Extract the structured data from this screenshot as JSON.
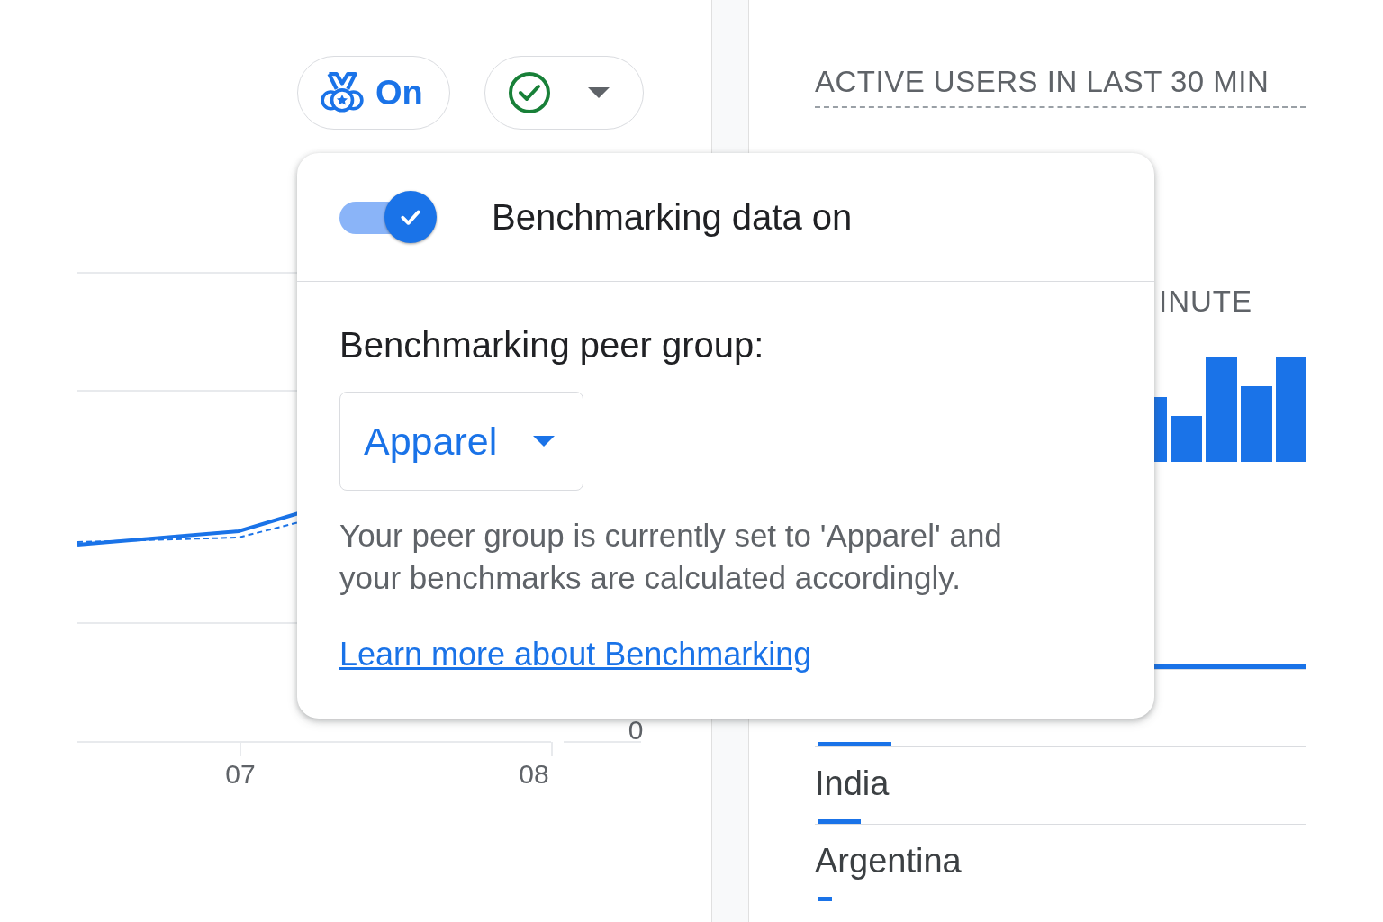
{
  "toolbar": {
    "benchmark_button": {
      "label": "On"
    }
  },
  "trend_chart": {
    "x_labels": [
      "07",
      "08"
    ],
    "y_labels": [
      "0"
    ]
  },
  "realtime": {
    "title": "ACTIVE USERS IN LAST 30 MIN",
    "subtitle": "INUTE",
    "countries": [
      {
        "level": 1
      },
      {
        "level": 0.15
      },
      {
        "name": "India",
        "level": 0.087
      },
      {
        "name": "Argentina",
        "level": 0.028
      }
    ]
  },
  "benchmark_popup": {
    "toggle": {
      "label": "Benchmarking data on",
      "on": true
    },
    "peer_group_label": "Benchmarking peer group:",
    "peer_group": {
      "value": "Apparel"
    },
    "description": "Your peer group is currently set to 'Apparel' and your benchmarks are calculated accordingly.",
    "link": "Learn more about Benchmarking"
  }
}
